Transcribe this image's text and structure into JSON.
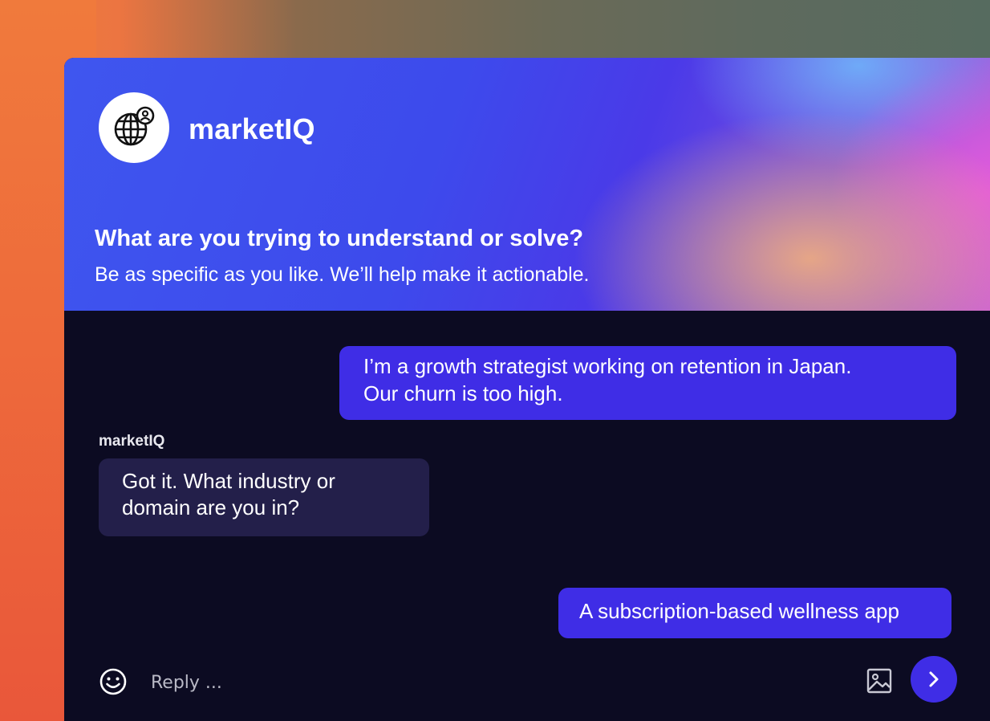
{
  "header": {
    "brand_name": "marketIQ",
    "question": "What are you trying to understand or solve?",
    "subtext": "Be as specific as you like. We’ll help make it actionable."
  },
  "messages": [
    {
      "role": "user",
      "text_line1": "I’m a growth strategist working on retention in Japan.",
      "text_line2": "Our churn is too high."
    },
    {
      "role": "bot",
      "sender": "marketIQ",
      "text_line1": "Got it. What industry or",
      "text_line2": "domain are you in?"
    },
    {
      "role": "user",
      "text": "A subscription-based wellness app"
    }
  ],
  "composer": {
    "placeholder": "Reply ...",
    "emoji_icon": "smiley-icon",
    "image_icon": "image-icon",
    "send_icon": "chevron-right-icon"
  },
  "colors": {
    "user_bubble": "#3f2de6",
    "bot_bubble": "#231f4a",
    "chat_background": "#0c0b22",
    "send_button": "#3f2de6"
  }
}
